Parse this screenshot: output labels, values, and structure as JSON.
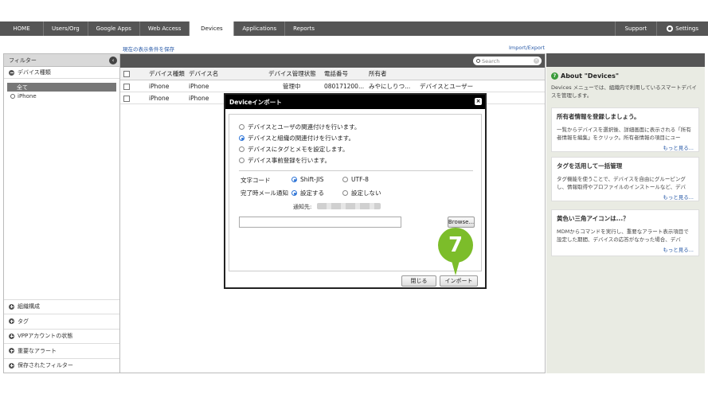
{
  "nav": {
    "tabs": [
      "HOME",
      "Users/Org",
      "Google Apps",
      "Web Access",
      "Devices",
      "Applications",
      "Reports"
    ],
    "active": "Devices",
    "support": "Support",
    "settings": "Settings"
  },
  "links": {
    "save_view": "現在の表示条件を保存",
    "import_export": "Import/Export"
  },
  "filter_panel": {
    "title": "フィルター",
    "device_type_section": "デバイス種類",
    "items": [
      "全て",
      "iPhone"
    ],
    "bottom_sections": [
      "組織構成",
      "タグ",
      "VPPアカウントの状態",
      "重要なアラート",
      "保存されたフィルター"
    ]
  },
  "device_list": {
    "search_placeholder": "Search",
    "columns": [
      "デバイス種類",
      "デバイス名",
      "デバイス管理状態",
      "電話番号",
      "所有者"
    ],
    "rows": [
      [
        "iPhone",
        "iPhone",
        "管理中",
        "080171200...",
        "みやにしりつ...",
        "デバイスとユーザー"
      ],
      [
        "iPhone",
        "iPhone",
        "",
        "",
        "",
        ""
      ]
    ]
  },
  "about_panel": {
    "title": "About \"Devices\"",
    "description": "Devices メニューでは、組織内で利用しているスマートデバイスを管理します。",
    "cards": [
      {
        "title": "所有者情報を登録しましょう。",
        "text": "一覧からデバイスを選択後、詳細画面に表示される「所有者情報を編集」をクリック。所有者情報の項目にユー",
        "more": "もっと見る..."
      },
      {
        "title": "タグを活用して一括管理",
        "text": "タグ機能を使うことで、デバイスを自由にグルーピングし、情報取得やプロファイルのインストールなど、デバ",
        "more": "もっと見る..."
      },
      {
        "title": "黄色い三角アイコンは...？",
        "text": "MDMからコマンドを実行し、重要なアラート表示項目で設定した期間、デバイスの応答がなかった場合、デバ",
        "more": "もっと見る..."
      }
    ]
  },
  "modal": {
    "title": "Deviceインポート",
    "options": [
      "デバイスとユーザの関連付けを行います。",
      "デバイスと組織の関連付けを行います。",
      "デバイスにタグとメモを設定します。",
      "デバイス事前登録を行います。"
    ],
    "charset_label": "文字コード",
    "charset_options": [
      "Shift-JIS",
      "UTF-8"
    ],
    "notify_label": "完了時メール通知",
    "notify_options": [
      "設定する",
      "設定しない"
    ],
    "notify_to_label": "通知先:",
    "browse": "Browse...",
    "close": "閉じる",
    "import": "インポート"
  },
  "step_marker": "7",
  "colors": {
    "nav_bg": "#555555",
    "marker_green": "#7cbd2a",
    "link_blue": "#2a5ba8",
    "radio_blue": "#2e74d6"
  }
}
